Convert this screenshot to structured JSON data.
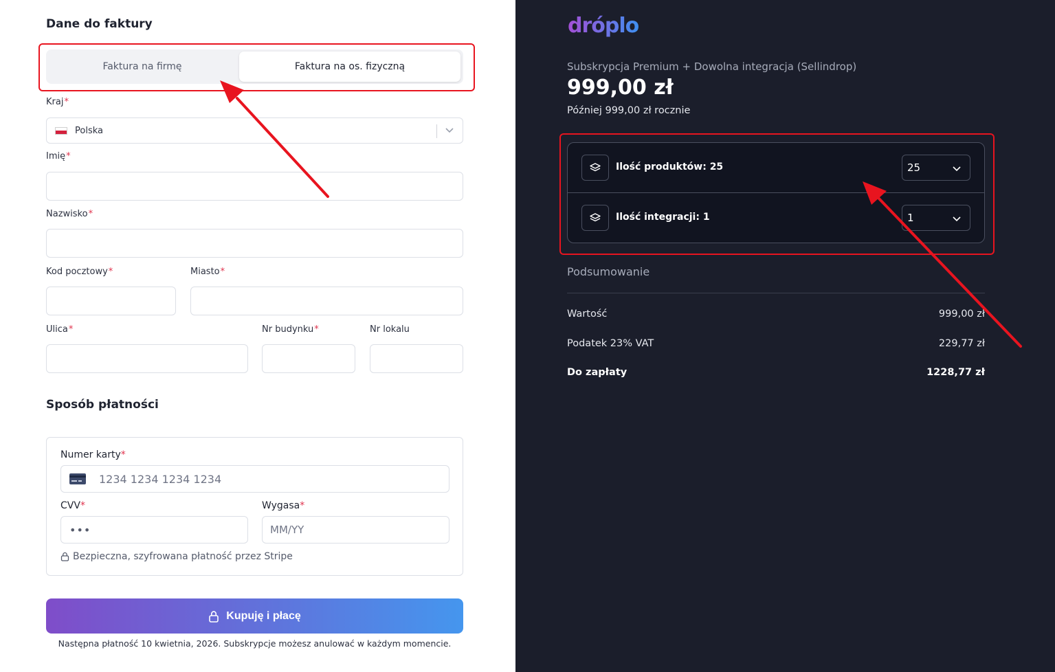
{
  "billing": {
    "title": "Dane do faktury",
    "invoice_tabs": [
      "Faktura na firmę",
      "Faktura na os. fizyczną"
    ],
    "active_tab_index": 1,
    "fields": {
      "country_label": "Kraj",
      "country_value": "Polska",
      "first_name_label": "Imię",
      "last_name_label": "Nazwisko",
      "postal_label": "Kod pocztowy",
      "city_label": "Miasto",
      "street_label": "Ulica",
      "building_label": "Nr budynku",
      "unit_label": "Nr lokalu"
    },
    "required_mark": "*"
  },
  "payment": {
    "title": "Sposób płatności",
    "card_label": "Numer karty",
    "card_placeholder": "1234 1234 1234 1234",
    "cvv_label": "CVV",
    "cvv_value": "•••",
    "expiry_label": "Wygasa",
    "expiry_placeholder": "MM/YY",
    "secure_note": "Bezpieczna, szyfrowana płatność przez Stripe",
    "buy_button": "Kupuję i płacę",
    "footnote": "Następna płatność 10 kwietnia, 2026. Subskrypcje możesz anulować w każdym momencie."
  },
  "summary": {
    "logo": "dróplo",
    "subscription_name": "Subskrypcja Premium + Dowolna integracja (Sellindrop)",
    "price": "999,00 zł",
    "later_price": "Później 999,00 zł rocznie",
    "options": [
      {
        "label": "Ilość produktów: 25",
        "value": "25"
      },
      {
        "label": "Ilość integracji: 1",
        "value": "1"
      }
    ],
    "section_title": "Podsumowanie",
    "rows": [
      {
        "label": "Wartość",
        "value": "999,00 zł"
      },
      {
        "label": "Podatek 23% VAT",
        "value": "229,77 zł"
      },
      {
        "label": "Do zapłaty",
        "value": "1228,77 zł"
      }
    ]
  },
  "colors": {
    "accent_red": "#e8141f",
    "dark_panel": "#1b1e2b",
    "gradient_start": "#7f4dc9",
    "gradient_end": "#4596ee"
  }
}
